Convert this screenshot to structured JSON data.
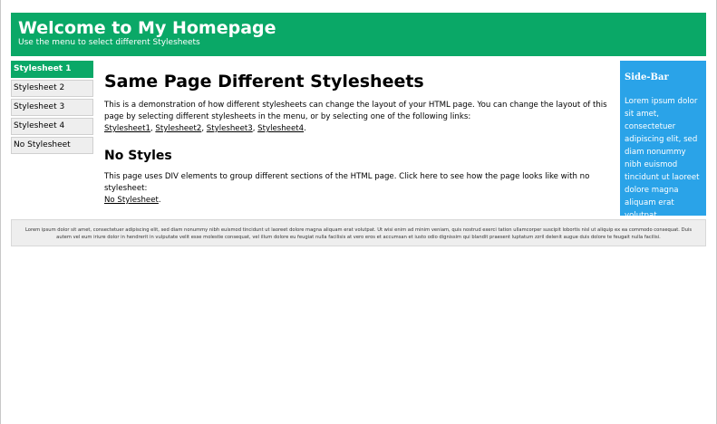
{
  "header": {
    "title": "Welcome to My Homepage",
    "subtitle": "Use the menu to select different Stylesheets"
  },
  "menu": {
    "items": [
      {
        "label": "Stylesheet 1"
      },
      {
        "label": "Stylesheet 2"
      },
      {
        "label": "Stylesheet 3"
      },
      {
        "label": "Stylesheet 4"
      },
      {
        "label": "No Stylesheet"
      }
    ],
    "active_index": 0
  },
  "main": {
    "heading": "Same Page Different Stylesheets",
    "intro": "This is a demonstration of how different stylesheets can change the layout of your HTML page. You can change the layout of this page by selecting different stylesheets in the menu, or by selecting one of the following links:",
    "links": [
      "Stylesheet1",
      "Stylesheet2",
      "Stylesheet3",
      "Stylesheet4"
    ],
    "links_end": ".",
    "subheading": "No Styles",
    "nostyle_text": "This page uses DIV elements to group different sections of the HTML page. Click here to see how the page looks like with no stylesheet:",
    "nostyle_link": "No Stylesheet",
    "nostyle_end": "."
  },
  "sidebar": {
    "title": "Side-Bar",
    "text": "Lorem ipsum dolor sit amet, consectetuer adipiscing elit, sed diam nonummy nibh euismod tincidunt ut laoreet dolore magna aliquam erat volutpat."
  },
  "footer": {
    "text": "Lorem ipsum dolor sit amet, consectetuer adipiscing elit, sed diam nonummy nibh euismod tincidunt ut laoreet dolore magna aliquam erat volutpat. Ut wisi enim ad minim veniam, quis nostrud exerci tation ullamcorper suscipit lobortis nisl ut aliquip ex ea commodo consequat. Duis autem vel eum iriure dolor in hendrerit in vulputate velit esse molestie consequat, vel illum dolore eu feugiat nulla facilisis at vero eros et accumsan et iusto odio dignissim qui blandit praesent luptatum zzril delenit augue duis dolore te feugait nulla facilisi."
  },
  "colors": {
    "header_bg": "#0aa867",
    "sidebar_bg": "#2aa3e8",
    "menu_active_bg": "#0aa867",
    "menu_bg": "#eeeeee",
    "footer_bg": "#eeeeee"
  }
}
